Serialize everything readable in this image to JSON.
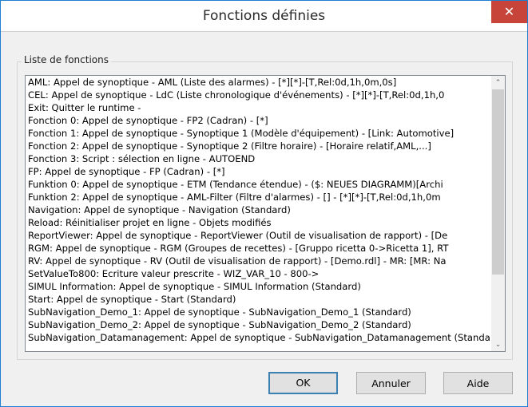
{
  "window": {
    "title": "Fonctions définies",
    "close_glyph": "✕"
  },
  "group": {
    "label": "Liste de fonctions"
  },
  "list": {
    "items": [
      "AML: Appel de synoptique - AML (Liste des alarmes) - [*][*]-[T,Rel:0d,1h,0m,0s]",
      "CEL: Appel de synoptique - LdC (Liste chronologique d'événements) - [*][*]-[T,Rel:0d,1h,0",
      "Exit: Quitter le runtime -",
      "Fonction 0: Appel de synoptique - FP2 (Cadran) - [*]",
      "Fonction 1: Appel de synoptique - Synoptique 1 (Modèle d'équipement) - [Link: Automotive]",
      "Fonction 2: Appel de synoptique - Synoptique 2 (Filtre horaire) - [Horaire relatif,AML,...]",
      "Fonction 3: Script : sélection en ligne - AUTOEND",
      "FP: Appel de synoptique - FP (Cadran) - [*]",
      "Funktion 0: Appel de synoptique - ETM (Tendance étendue) - ($: NEUES DIAGRAMM)[Archi",
      "Funktion 2: Appel de synoptique - AML-Filter (Filtre d'alarmes) - [] - [*][*]-[T,Rel:0d,1h,0m",
      "Navigation: Appel de synoptique - Navigation (Standard)",
      "Reload: Réinitialiser projet en ligne - Objets modifiés",
      "ReportViewer: Appel de synoptique - ReportViewer (Outil de visualisation de rapport) - [De",
      "RGM: Appel de synoptique - RGM (Groupes de recettes) - [Gruppo ricetta 0->Ricetta 1], RT",
      "RV: Appel de synoptique - RV (Outil de visualisation de rapport) - [Demo.rdl] - MR: [MR: Na",
      "SetValueTo800: Ecriture valeur prescrite - WIZ_VAR_10 - 800->",
      "SIMUL Information: Appel de synoptique - SIMUL Information (Standard)",
      "Start: Appel de synoptique - Start (Standard)",
      "SubNavigation_Demo_1: Appel de synoptique - SubNavigation_Demo_1 (Standard)",
      "SubNavigation_Demo_2: Appel de synoptique - SubNavigation_Demo_2 (Standard)",
      "SubNavigation_Datamanagement: Appel de synoptique - SubNavigation_Datamanagement (Standard)"
    ]
  },
  "scrollbar": {
    "up_glyph": "⌃",
    "down_glyph": "⌄"
  },
  "buttons": {
    "ok": "OK",
    "cancel": "Annuler",
    "help": "Aide"
  }
}
